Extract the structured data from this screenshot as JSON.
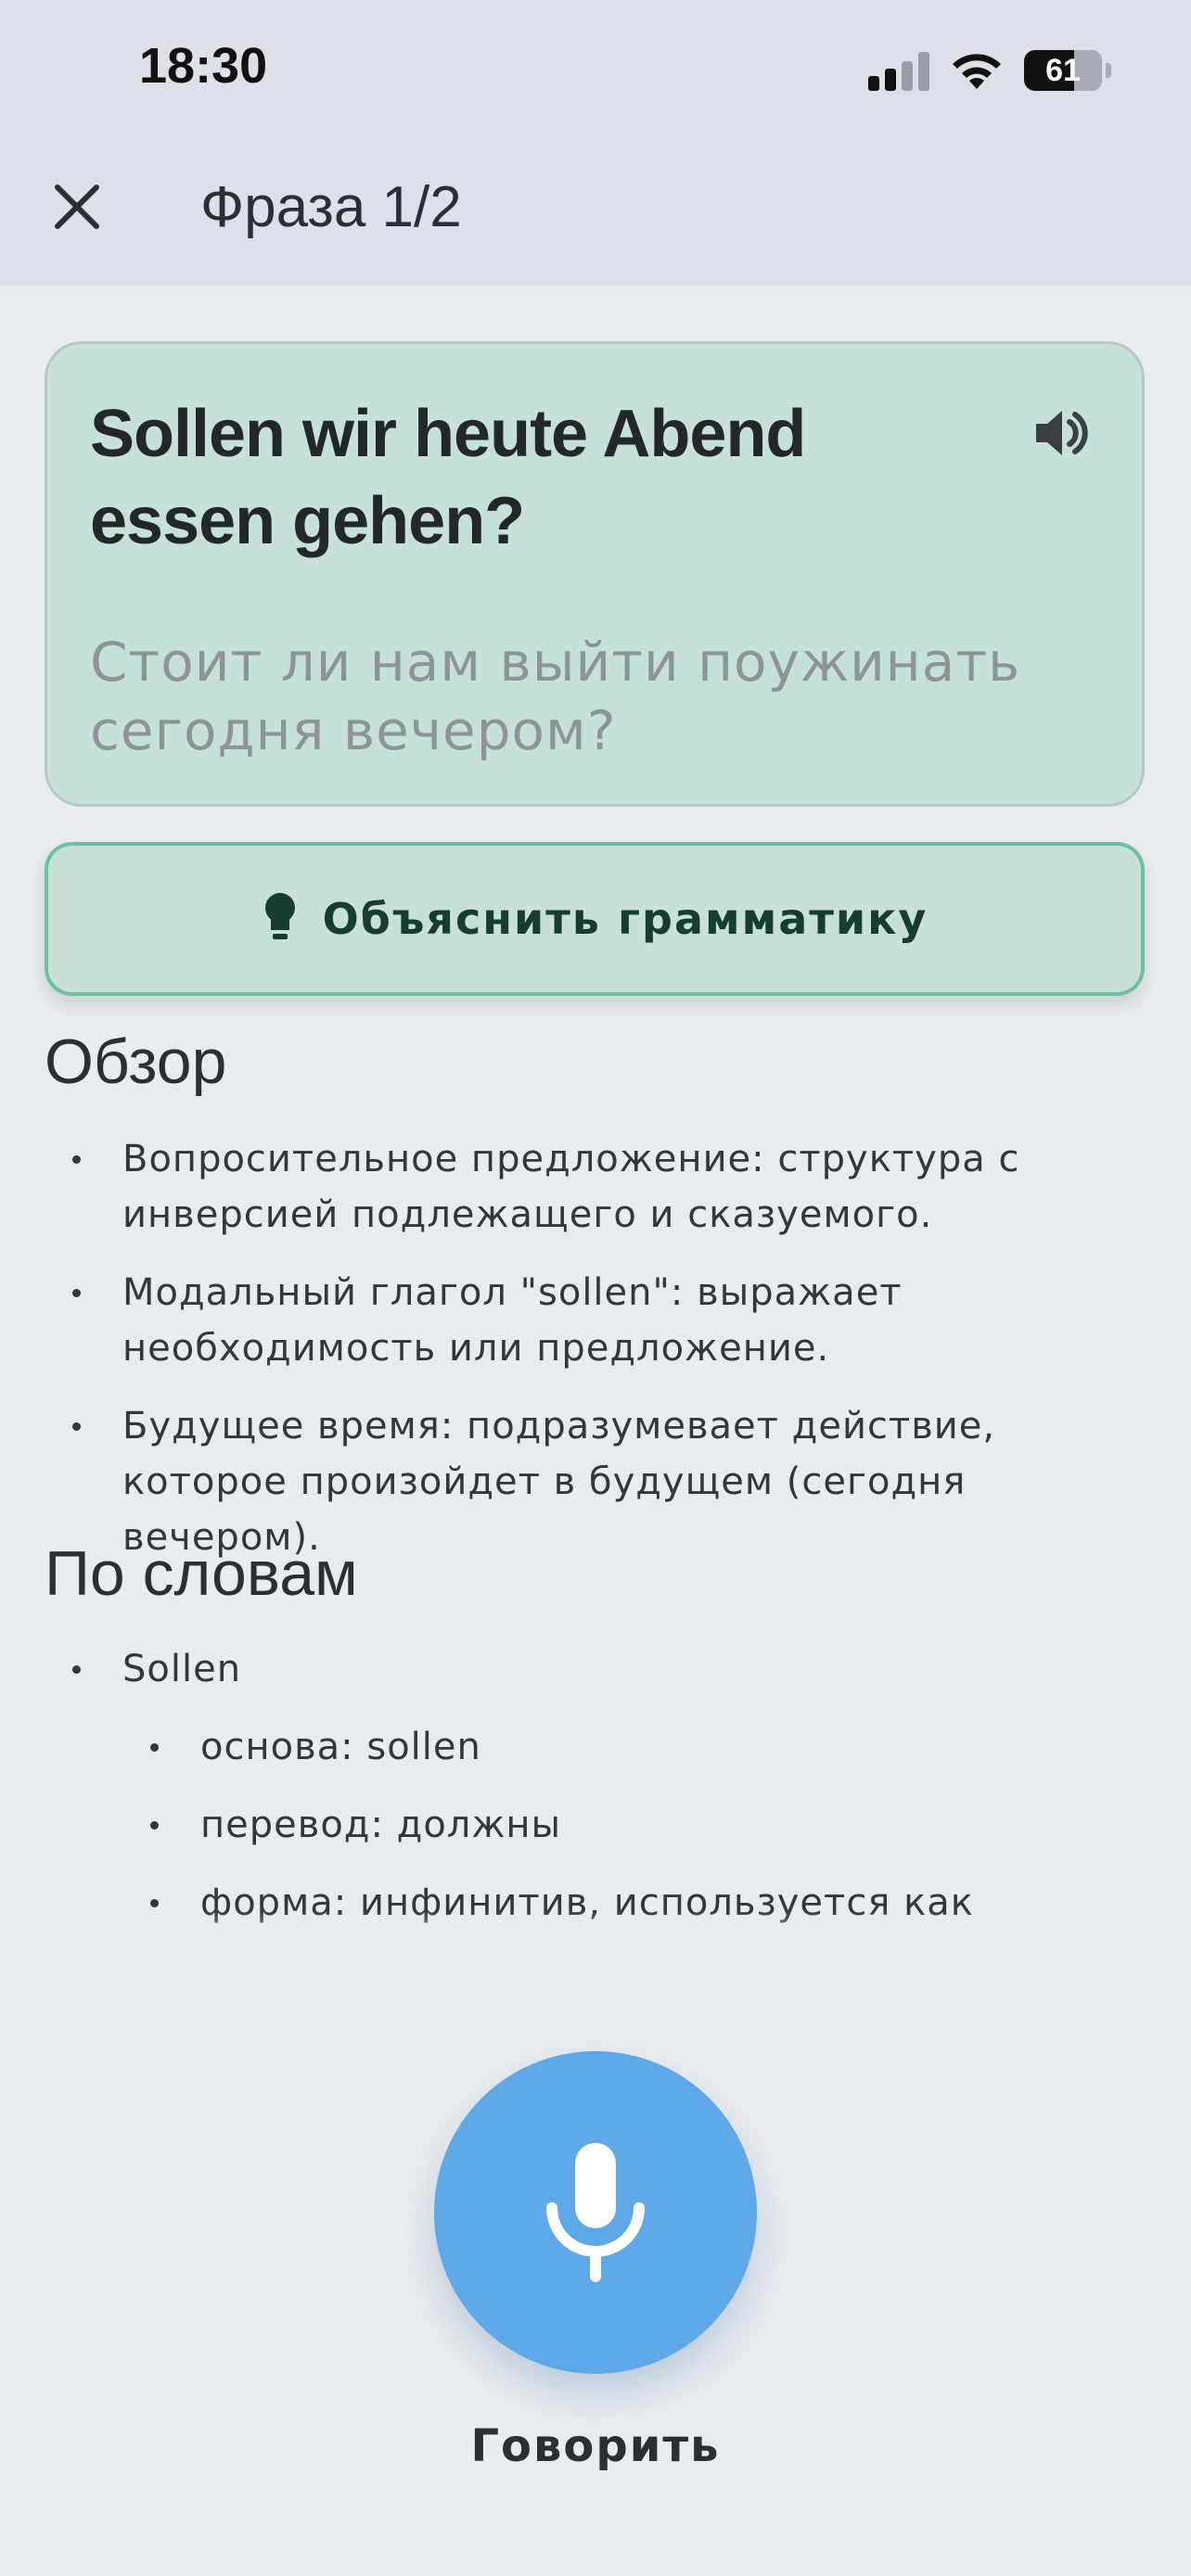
{
  "status_bar": {
    "time": "18:30",
    "battery": "61",
    "icons": [
      "cellular-signal-icon",
      "wifi-icon",
      "battery-icon"
    ]
  },
  "header": {
    "title": "Фраза 1/2",
    "close_icon": "close-icon"
  },
  "phrase": {
    "german": "Sollen wir heute Abend essen gehen?",
    "translation": "Стоит ли нам выйти поужинать сегодня вечером?",
    "speaker_icon": "speaker-icon"
  },
  "explain_button": {
    "label": "Объяснить грамматику",
    "icon": "lightbulb-icon"
  },
  "overview": {
    "heading": "Обзор",
    "items": [
      "Вопросительное предложение: структура с инверсией подлежащего и сказуемого.",
      "Модальный глагол \"sollen\": выражает необходимость или предложение.",
      "Будущее время: подразумевает действие, которое произойдет в будущем (сегодня вечером)."
    ]
  },
  "by_words": {
    "heading": "По словам",
    "word": "Sollen",
    "details": [
      "основа: sollen",
      "перевод: должны",
      "форма: инфинитив, используется как"
    ]
  },
  "speak_button": {
    "label": "Говорить",
    "icon": "microphone-icon"
  },
  "colors": {
    "background": "#e9ecef",
    "card": "#c5e1da",
    "accent_green": "#6dc09f",
    "mic_blue": "#5ea8e8"
  }
}
